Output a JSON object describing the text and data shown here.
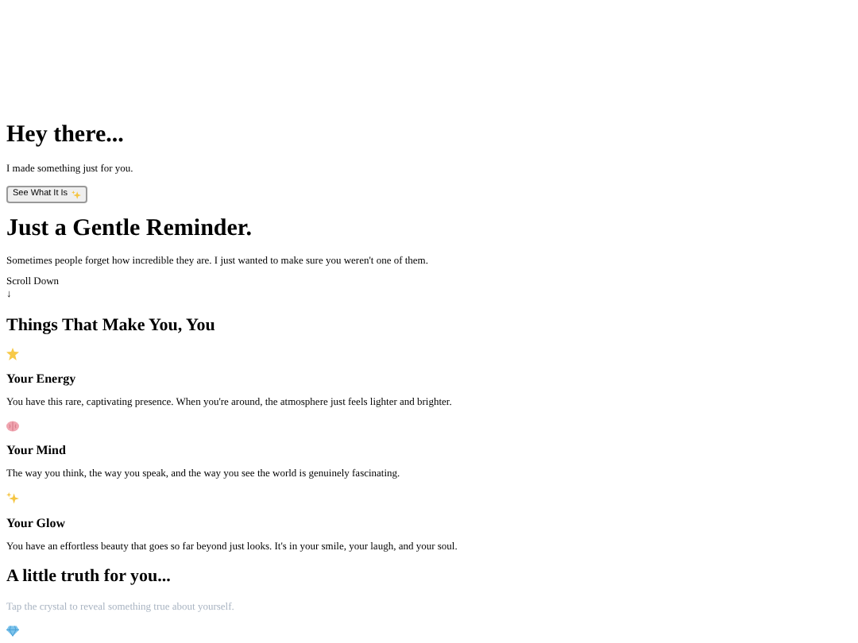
{
  "intro": {
    "heading": "Hey there...",
    "text": "I made something just for you.",
    "button": "See What It Is"
  },
  "reminder": {
    "heading": "Just a Gentle Reminder.",
    "text": "Sometimes people forget how incredible they are. I just wanted to make sure you weren't one of them.",
    "scroll_label": "Scroll Down",
    "scroll_arrow": "↓"
  },
  "traits": {
    "heading": "Things That Make You, You",
    "items": [
      {
        "title": "Your Energy",
        "text": "You have this rare, captivating presence. When you're around, the atmosphere just feels lighter and brighter."
      },
      {
        "title": "Your Mind",
        "text": "The way you think, the way you speak, and the way you see the world is genuinely fascinating."
      },
      {
        "title": "Your Glow",
        "text": "You have an effortless beauty that goes so far beyond just looks. It's in your smile, your laugh, and your soul."
      }
    ]
  },
  "truth": {
    "heading": "A little truth for you...",
    "hint": "Tap the crystal to reveal something true about yourself."
  }
}
